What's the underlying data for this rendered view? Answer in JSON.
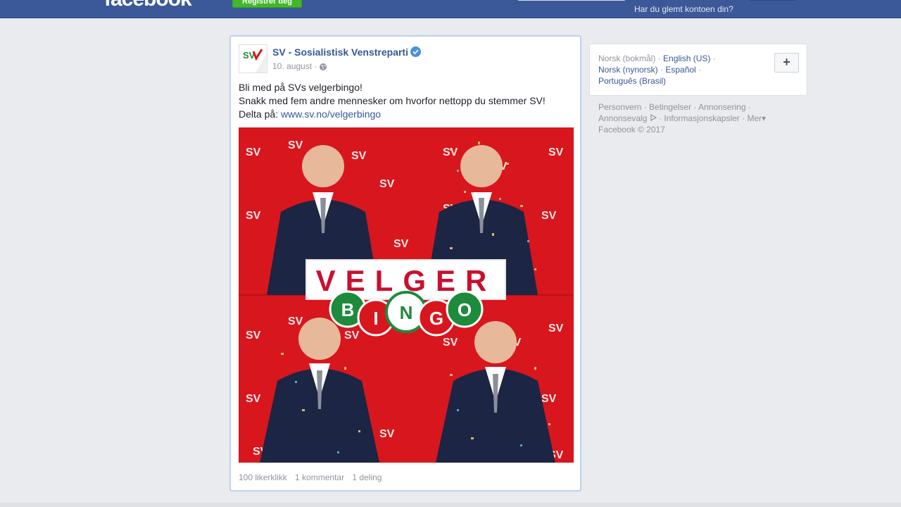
{
  "header": {
    "logo": "facebook",
    "register_label": "Registrer deg",
    "forgot_account": "Har du glemt kontoen din?"
  },
  "post": {
    "page_name": "SV - Sosialistisk Venstreparti",
    "avatar_text": "SV",
    "date": "10. august",
    "text_lines": [
      "Bli med på SVs velgerbingo!",
      "Snakk med fem andre mennesker om hvorfor nettopp du stemmer SV!"
    ],
    "link_prefix": "Delta på:",
    "link_text": "www.sv.no/velgerbingo",
    "image_title": "VELGER",
    "image_subtitle_letters": [
      "B",
      "I",
      "N",
      "G",
      "O"
    ],
    "logo_text": "SV",
    "stats": {
      "likes": "100 likerklikk",
      "comments": "1 kommentar",
      "shares": "1 deling"
    }
  },
  "languages": {
    "items": [
      {
        "label": "Norsk (bokmål)",
        "active": true
      },
      {
        "label": "English (US)",
        "active": false
      },
      {
        "label": "Norsk (nynorsk)",
        "active": false
      },
      {
        "label": "Español",
        "active": false
      },
      {
        "label": "Português (Brasil)",
        "active": false
      }
    ],
    "add_label": "+"
  },
  "footer": {
    "links": [
      "Personvern",
      "Betingelser",
      "Annonsering",
      "Annonsevalg",
      "Informasjonskapsler",
      "Mer"
    ],
    "copyright": "Facebook © 2017"
  },
  "colors": {
    "brand_blue": "#3b5998",
    "link_blue": "#365899",
    "register_green": "#42b72a",
    "poster_red": "#d8161d",
    "bingo_green": "#1e8a3c"
  }
}
